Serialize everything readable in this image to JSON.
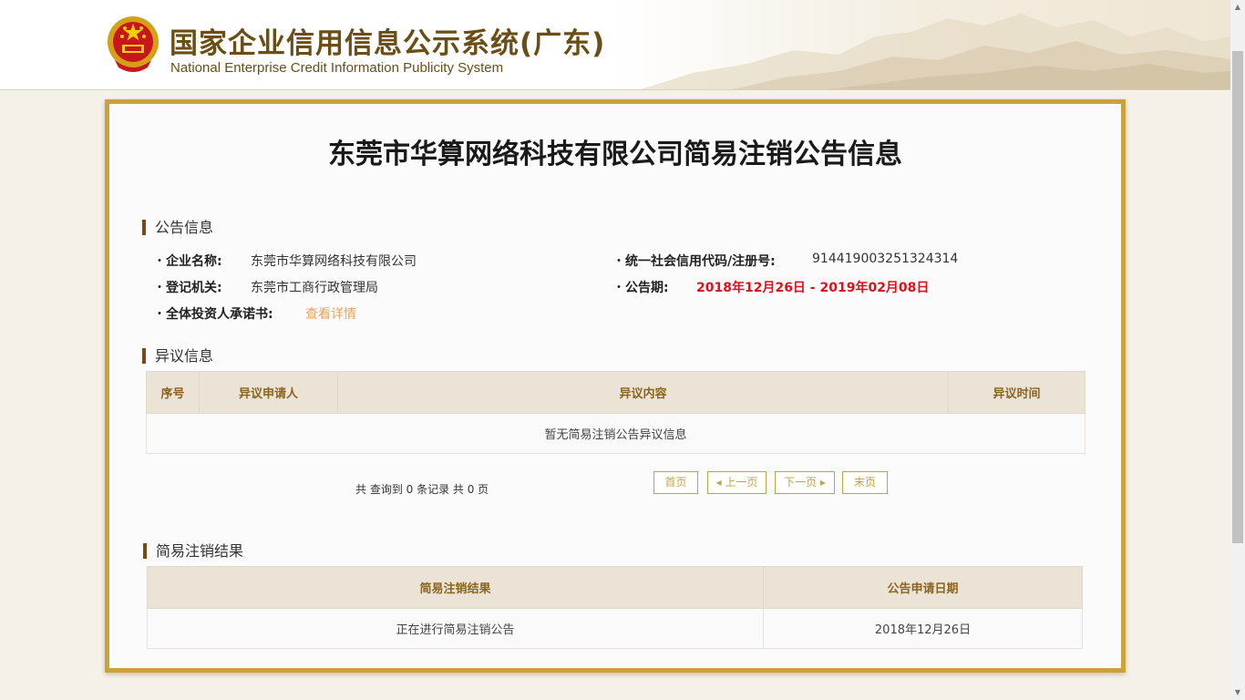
{
  "header": {
    "title_cn": "国家企业信用信息公示系统(广东)",
    "title_en": "National Enterprise Credit Information Publicity System"
  },
  "page_title": "东莞市华算网络科技有限公司简易注销公告信息",
  "announcement": {
    "section_title": "公告信息",
    "company_name_label": "企业名称:",
    "company_name": "东莞市华算网络科技有限公司",
    "credit_code_label": "统一社会信用代码/注册号:",
    "credit_code": "914419003251324314",
    "authority_label": "登记机关:",
    "authority": "东莞市工商行政管理局",
    "period_label": "公告期:",
    "period": "2018年12月26日 - 2019年02月08日",
    "commitment_label": "全体投资人承诺书:",
    "commitment_link": "查看详情"
  },
  "objection": {
    "section_title": "异议信息",
    "columns": [
      "序号",
      "异议申请人",
      "异议内容",
      "异议时间"
    ],
    "empty_text": "暂无简易注销公告异议信息",
    "pager_info": "共 查询到 0 条记录 共 0 页",
    "pager": {
      "first": "首页",
      "prev": "◂ 上一页",
      "next": "下一页 ▸",
      "last": "末页"
    }
  },
  "result": {
    "section_title": "简易注销结果",
    "columns": [
      "简易注销结果",
      "公告申请日期"
    ],
    "rows": [
      [
        "正在进行简易注销公告",
        "2018年12月26日"
      ]
    ]
  },
  "colors": {
    "brand": "#6b4e16",
    "border_gold": "#c9a23c",
    "highlight_red": "#e0101a",
    "link_orange": "#e8a45a"
  }
}
